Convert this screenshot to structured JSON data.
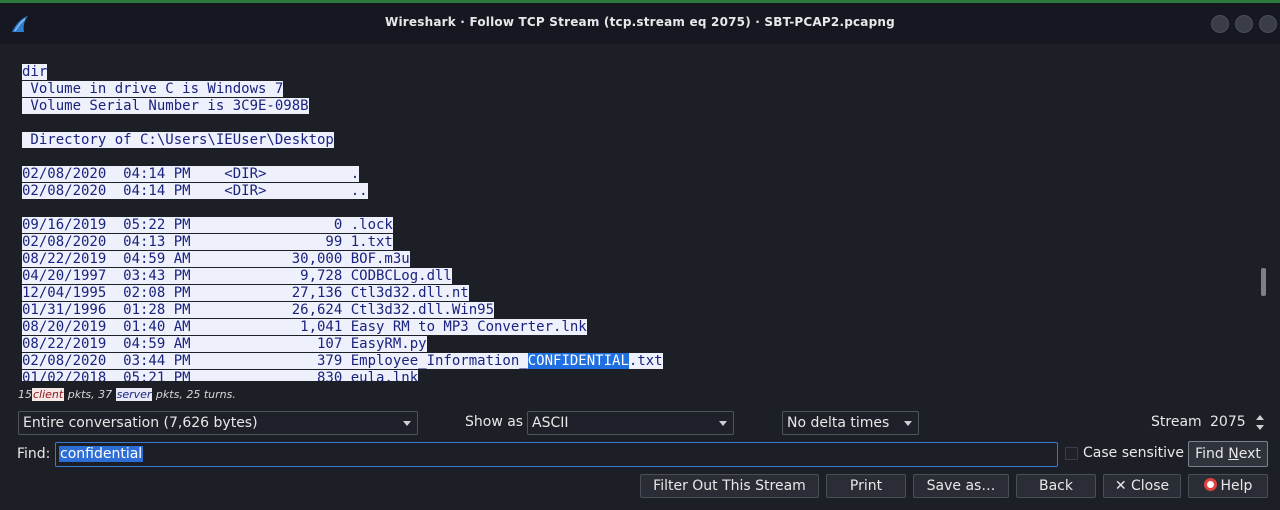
{
  "window": {
    "title": "Wireshark · Follow TCP Stream (tcp.stream eq 2075) · SBT-PCAP2.pcapng"
  },
  "stream": {
    "lines": [
      {
        "text": "dir",
        "type": "cmd"
      },
      {
        "text": " Volume in drive C is Windows 7",
        "type": "out"
      },
      {
        "text": " Volume Serial Number is 3C9E-098B",
        "type": "out"
      },
      {
        "text": "",
        "type": "out"
      },
      {
        "text": " Directory of C:\\Users\\IEUser\\Desktop",
        "type": "out"
      },
      {
        "text": "",
        "type": "out"
      },
      {
        "text": "02/08/2020  04:14 PM    <DIR>          .",
        "type": "out"
      },
      {
        "text": "02/08/2020  04:14 PM    <DIR>          ..",
        "type": "out"
      },
      {
        "text": "",
        "type": "out"
      },
      {
        "text": "09/16/2019  05:22 PM                 0 .lock",
        "type": "out"
      },
      {
        "text": "02/08/2020  04:13 PM                99 1.txt",
        "type": "out"
      },
      {
        "text": "08/22/2019  04:59 AM            30,000 BOF.m3u",
        "type": "out"
      },
      {
        "text": "04/20/1997  03:43 PM             9,728 CODBCLog.dll",
        "type": "out"
      },
      {
        "text": "12/04/1995  02:08 PM            27,136 Ctl3d32.dll.nt",
        "type": "out"
      },
      {
        "text": "01/31/1996  01:28 PM            26,624 Ctl3d32.dll.Win95",
        "type": "out"
      },
      {
        "text": "08/20/2019  01:40 AM             1,041 Easy RM to MP3 Converter.lnk",
        "type": "out"
      },
      {
        "text": "08/22/2019  04:59 AM               107 EasyRM.py",
        "type": "out"
      },
      {
        "text": "02/08/2020  03:44 PM               379 Employee_Information_",
        "match": "CONFIDENTIAL",
        "after": ".txt",
        "type": "out"
      },
      {
        "text": "01/02/2018  05:21 PM               830 eula.lnk",
        "type": "out"
      }
    ]
  },
  "stats": {
    "client_count": "15",
    "client_label": "client",
    "middle": " pkts, 37 ",
    "server_label": "server",
    "tail": " pkts, 25 turns."
  },
  "controls": {
    "conversation": "Entire conversation (7,626 bytes)",
    "show_as_label": "Show as",
    "show_as_value": "ASCII",
    "delta_times": "No delta times",
    "stream_label": "Stream",
    "stream_value": "2075",
    "find_label": "Find:",
    "find_value": "confidential",
    "case_sensitive_label": "Case sensitive",
    "find_next_pre": "Find ",
    "find_next_u": "N",
    "find_next_post": "ext"
  },
  "buttons": {
    "filter_out": "Filter Out This Stream",
    "print": "Print",
    "save_as": "Save as…",
    "back": "Back",
    "close": "✕ Close",
    "help": "Help"
  },
  "colors": {
    "client_text": "#8a1414",
    "server_text": "#1a237e",
    "match_highlight": "#1f6fe0"
  }
}
